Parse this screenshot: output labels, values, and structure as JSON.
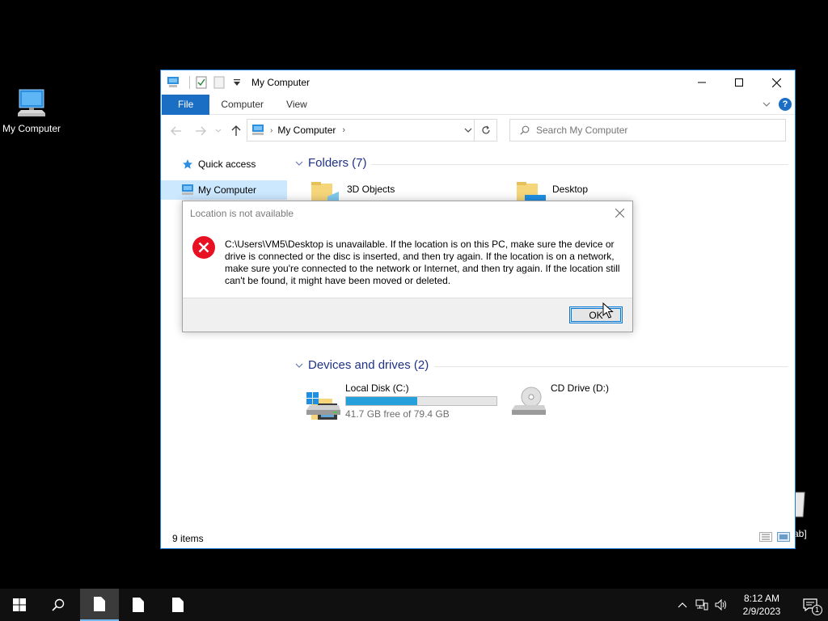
{
  "desktop": {
    "my_computer_label": "My Computer",
    "recycle_partial_label": "ab]"
  },
  "window": {
    "title": "My Computer",
    "tabs": {
      "file": "File",
      "computer": "Computer",
      "view": "View"
    },
    "address": {
      "path": "My Computer"
    },
    "search": {
      "placeholder": "Search My Computer"
    },
    "nav": {
      "quick_access": "Quick access",
      "my_computer": "My Computer"
    },
    "folders": {
      "header": "Folders (7)",
      "items": [
        {
          "label": "3D Objects"
        },
        {
          "label": "Desktop"
        }
      ]
    },
    "drives": {
      "header": "Devices and drives (2)",
      "local_disk": {
        "name": "Local Disk (C:)",
        "free_text": "41.7 GB free of 79.4 GB",
        "used_fraction": 0.475
      },
      "cd_drive": {
        "name": "CD Drive (D:)"
      }
    },
    "status": {
      "items": "9 items"
    }
  },
  "dialog": {
    "title": "Location is not available",
    "message": "C:\\Users\\VM5\\Desktop is unavailable. If the location is on this PC, make sure the device or drive is connected or the disc is inserted, and then try again. If the location is on a network, make sure you're connected to the network or Internet, and then try again. If the location still can't be found, it might have been moved or deleted.",
    "ok_label": "OK"
  },
  "taskbar": {
    "time": "8:12 AM",
    "date": "2/9/2023",
    "notification_count": "1"
  },
  "colors": {
    "accent": "#1a6fc4",
    "drive_bar": "#26a0da",
    "error_red": "#e81123",
    "selection": "#cce8ff",
    "group_header": "#1e3287"
  }
}
